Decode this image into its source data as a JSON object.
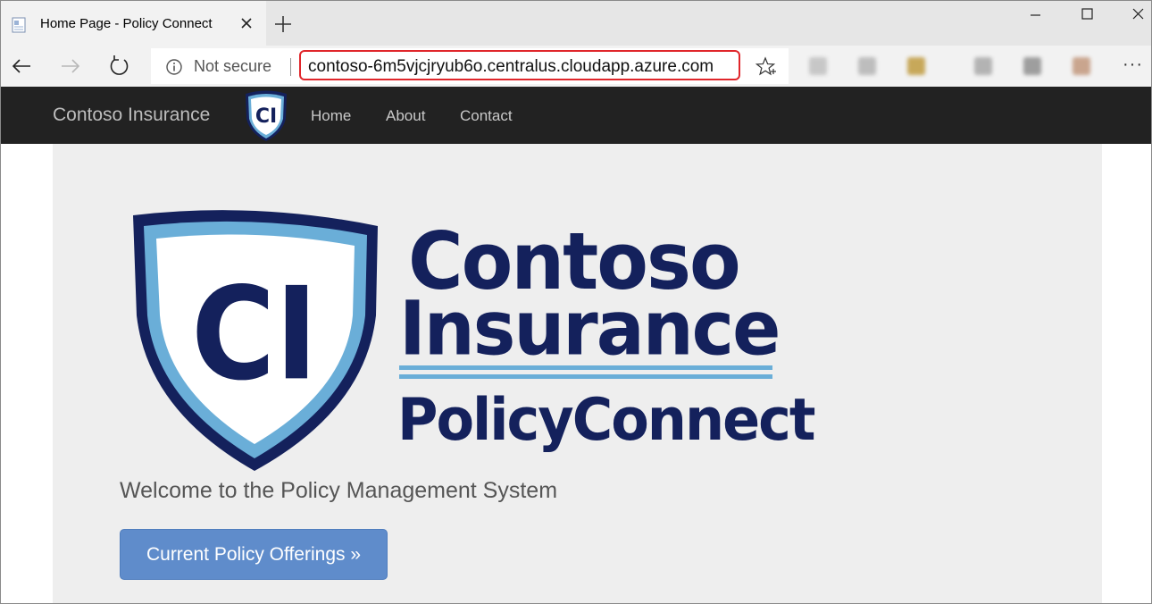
{
  "browser": {
    "tab_title": "Home Page - Policy Connect",
    "security_label": "Not secure",
    "url": "contoso-6m5vjcjryub6o.centralus.cloudapp.azure.com",
    "more_label": "···",
    "url_highlight_color": "#e0262b"
  },
  "site": {
    "brand": "Contoso Insurance",
    "logo_initials": "CI",
    "nav_links": [
      "Home",
      "About",
      "Contact"
    ],
    "navbar_color": "#222222"
  },
  "hero": {
    "logo_word_1": "Contoso",
    "logo_word_2": "Insurance",
    "logo_word_3": "PolicyConnect",
    "logo_initials": "CI",
    "logo_color": "#14215c",
    "accent_color": "#6aaed8",
    "welcome_text": "Welcome to the Policy Management System",
    "cta_label": "Current Policy Offerings »",
    "cta_color": "#5f8ccb"
  }
}
